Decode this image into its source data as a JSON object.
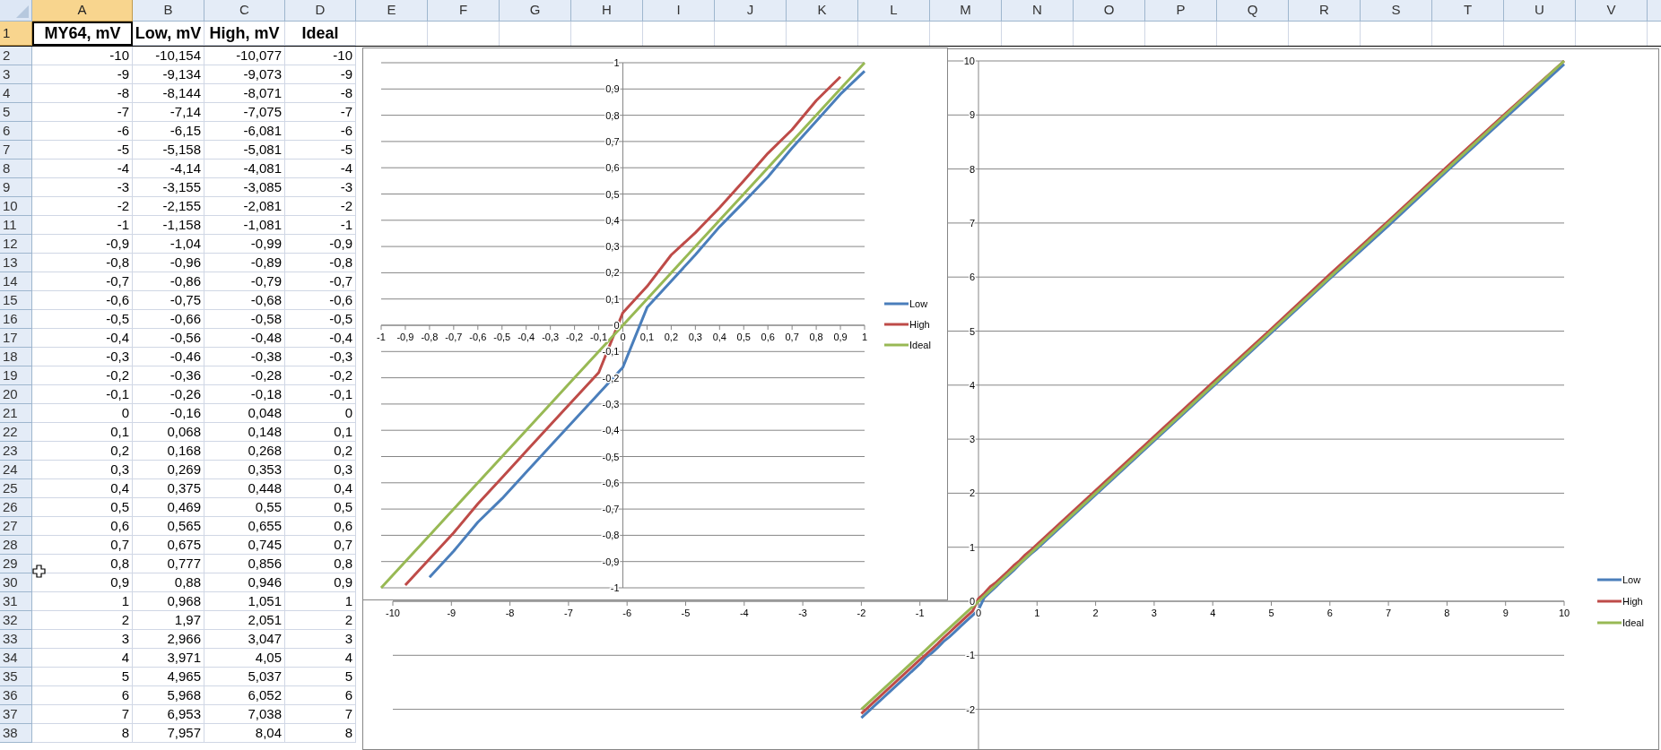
{
  "sheet": {
    "columns": [
      {
        "label": "A",
        "selected": true
      },
      {
        "label": "B",
        "selected": false
      },
      {
        "label": "C",
        "selected": false
      },
      {
        "label": "D",
        "selected": false
      },
      {
        "label": "E",
        "selected": false
      },
      {
        "label": "F",
        "selected": false
      },
      {
        "label": "G",
        "selected": false
      },
      {
        "label": "H",
        "selected": false
      },
      {
        "label": "I",
        "selected": false
      },
      {
        "label": "J",
        "selected": false
      },
      {
        "label": "K",
        "selected": false
      },
      {
        "label": "L",
        "selected": false
      },
      {
        "label": "M",
        "selected": false
      },
      {
        "label": "N",
        "selected": false
      },
      {
        "label": "O",
        "selected": false
      },
      {
        "label": "P",
        "selected": false
      },
      {
        "label": "Q",
        "selected": false
      },
      {
        "label": "R",
        "selected": false
      },
      {
        "label": "S",
        "selected": false
      },
      {
        "label": "T",
        "selected": false
      },
      {
        "label": "U",
        "selected": false
      },
      {
        "label": "V",
        "selected": false
      }
    ],
    "rows": [
      {
        "number": "1",
        "kind": "header",
        "selected": true,
        "cells": [
          "MY64, mV",
          "Low, mV",
          "High, mV",
          "Ideal"
        ]
      },
      {
        "number": "2",
        "kind": "data",
        "selected": false,
        "cells": [
          "-10",
          "-10,154",
          "-10,077",
          "-10"
        ]
      },
      {
        "number": "3",
        "kind": "data",
        "selected": false,
        "cells": [
          "-9",
          "-9,134",
          "-9,073",
          "-9"
        ]
      },
      {
        "number": "4",
        "kind": "data",
        "selected": false,
        "cells": [
          "-8",
          "-8,144",
          "-8,071",
          "-8"
        ]
      },
      {
        "number": "5",
        "kind": "data",
        "selected": false,
        "cells": [
          "-7",
          "-7,14",
          "-7,075",
          "-7"
        ]
      },
      {
        "number": "6",
        "kind": "data",
        "selected": false,
        "cells": [
          "-6",
          "-6,15",
          "-6,081",
          "-6"
        ]
      },
      {
        "number": "7",
        "kind": "data",
        "selected": false,
        "cells": [
          "-5",
          "-5,158",
          "-5,081",
          "-5"
        ]
      },
      {
        "number": "8",
        "kind": "data",
        "selected": false,
        "cells": [
          "-4",
          "-4,14",
          "-4,081",
          "-4"
        ]
      },
      {
        "number": "9",
        "kind": "data",
        "selected": false,
        "cells": [
          "-3",
          "-3,155",
          "-3,085",
          "-3"
        ]
      },
      {
        "number": "10",
        "kind": "data",
        "selected": false,
        "cells": [
          "-2",
          "-2,155",
          "-2,081",
          "-2"
        ]
      },
      {
        "number": "11",
        "kind": "data",
        "selected": false,
        "cells": [
          "-1",
          "-1,158",
          "-1,081",
          "-1"
        ]
      },
      {
        "number": "12",
        "kind": "data",
        "selected": false,
        "cells": [
          "-0,9",
          "-1,04",
          "-0,99",
          "-0,9"
        ]
      },
      {
        "number": "13",
        "kind": "data",
        "selected": false,
        "cells": [
          "-0,8",
          "-0,96",
          "-0,89",
          "-0,8"
        ]
      },
      {
        "number": "14",
        "kind": "data",
        "selected": false,
        "cells": [
          "-0,7",
          "-0,86",
          "-0,79",
          "-0,7"
        ]
      },
      {
        "number": "15",
        "kind": "data",
        "selected": false,
        "cells": [
          "-0,6",
          "-0,75",
          "-0,68",
          "-0,6"
        ]
      },
      {
        "number": "16",
        "kind": "data",
        "selected": false,
        "cells": [
          "-0,5",
          "-0,66",
          "-0,58",
          "-0,5"
        ]
      },
      {
        "number": "17",
        "kind": "data",
        "selected": false,
        "cells": [
          "-0,4",
          "-0,56",
          "-0,48",
          "-0,4"
        ]
      },
      {
        "number": "18",
        "kind": "data",
        "selected": false,
        "cells": [
          "-0,3",
          "-0,46",
          "-0,38",
          "-0,3"
        ]
      },
      {
        "number": "19",
        "kind": "data",
        "selected": false,
        "cells": [
          "-0,2",
          "-0,36",
          "-0,28",
          "-0,2"
        ]
      },
      {
        "number": "20",
        "kind": "data",
        "selected": false,
        "cells": [
          "-0,1",
          "-0,26",
          "-0,18",
          "-0,1"
        ]
      },
      {
        "number": "21",
        "kind": "data",
        "selected": false,
        "cells": [
          "0",
          "-0,16",
          "0,048",
          "0"
        ]
      },
      {
        "number": "22",
        "kind": "data",
        "selected": false,
        "cells": [
          "0,1",
          "0,068",
          "0,148",
          "0,1"
        ]
      },
      {
        "number": "23",
        "kind": "data",
        "selected": false,
        "cells": [
          "0,2",
          "0,168",
          "0,268",
          "0,2"
        ]
      },
      {
        "number": "24",
        "kind": "data",
        "selected": false,
        "cells": [
          "0,3",
          "0,269",
          "0,353",
          "0,3"
        ]
      },
      {
        "number": "25",
        "kind": "data",
        "selected": false,
        "cells": [
          "0,4",
          "0,375",
          "0,448",
          "0,4"
        ]
      },
      {
        "number": "26",
        "kind": "data",
        "selected": false,
        "cells": [
          "0,5",
          "0,469",
          "0,55",
          "0,5"
        ]
      },
      {
        "number": "27",
        "kind": "data",
        "selected": false,
        "cells": [
          "0,6",
          "0,565",
          "0,655",
          "0,6"
        ]
      },
      {
        "number": "28",
        "kind": "data",
        "selected": false,
        "cells": [
          "0,7",
          "0,675",
          "0,745",
          "0,7"
        ]
      },
      {
        "number": "29",
        "kind": "data",
        "selected": false,
        "cells": [
          "0,8",
          "0,777",
          "0,856",
          "0,8"
        ]
      },
      {
        "number": "30",
        "kind": "data",
        "selected": false,
        "cells": [
          "0,9",
          "0,88",
          "0,946",
          "0,9"
        ]
      },
      {
        "number": "31",
        "kind": "data",
        "selected": false,
        "cells": [
          "1",
          "0,968",
          "1,051",
          "1"
        ]
      },
      {
        "number": "32",
        "kind": "data",
        "selected": false,
        "cells": [
          "2",
          "1,97",
          "2,051",
          "2"
        ]
      },
      {
        "number": "33",
        "kind": "data",
        "selected": false,
        "cells": [
          "3",
          "2,966",
          "3,047",
          "3"
        ]
      },
      {
        "number": "34",
        "kind": "data",
        "selected": false,
        "cells": [
          "4",
          "3,971",
          "4,05",
          "4"
        ]
      },
      {
        "number": "35",
        "kind": "data",
        "selected": false,
        "cells": [
          "5",
          "4,965",
          "5,037",
          "5"
        ]
      },
      {
        "number": "36",
        "kind": "data",
        "selected": false,
        "cells": [
          "6",
          "5,968",
          "6,052",
          "6"
        ]
      },
      {
        "number": "37",
        "kind": "data",
        "selected": false,
        "cells": [
          "7",
          "6,953",
          "7,038",
          "7"
        ]
      },
      {
        "number": "38",
        "kind": "data",
        "selected": false,
        "cells": [
          "8",
          "7,957",
          "8,04",
          "8"
        ]
      }
    ]
  },
  "charts": [
    {
      "chart_data": {
        "type": "line",
        "grid": true,
        "legend": true,
        "x": [
          -1,
          -0.9,
          -0.8,
          -0.7,
          -0.6,
          -0.5,
          -0.4,
          -0.3,
          -0.2,
          -0.1,
          0,
          0.1,
          0.2,
          0.3,
          0.4,
          0.5,
          0.6,
          0.7,
          0.8,
          0.9,
          1
        ],
        "series": [
          {
            "name": "Low",
            "color": "#4a7ebb",
            "values": [
              null,
              null,
              -0.96,
              -0.86,
              -0.75,
              -0.66,
              -0.56,
              -0.46,
              -0.36,
              -0.26,
              -0.16,
              0.068,
              0.168,
              0.269,
              0.375,
              0.469,
              0.565,
              0.675,
              0.777,
              0.88,
              0.968
            ]
          },
          {
            "name": "High",
            "color": "#be4b48",
            "values": [
              null,
              -0.99,
              -0.89,
              -0.79,
              -0.68,
              -0.58,
              -0.48,
              -0.38,
              -0.28,
              -0.18,
              0.048,
              0.148,
              0.268,
              0.353,
              0.448,
              0.55,
              0.655,
              0.745,
              0.856,
              0.946,
              null
            ]
          },
          {
            "name": "Ideal",
            "color": "#98b954",
            "values": [
              -1,
              -0.9,
              -0.8,
              -0.7,
              -0.6,
              -0.5,
              -0.4,
              -0.3,
              -0.2,
              -0.1,
              0,
              0.1,
              0.2,
              0.3,
              0.4,
              0.5,
              0.6,
              0.7,
              0.8,
              0.9,
              1
            ]
          }
        ],
        "xlim": [
          -1,
          1
        ],
        "ylim": [
          -1,
          1
        ],
        "xticks": [
          -1,
          {
            "value": -0.9,
            "label": "-0,9"
          },
          {
            "value": -0.8,
            "label": "-0,8"
          },
          {
            "value": -0.7,
            "label": "-0,7"
          },
          {
            "value": -0.6,
            "label": "-0,6"
          },
          {
            "value": -0.5,
            "label": "-0,5"
          },
          {
            "value": -0.4,
            "label": "-0,4"
          },
          {
            "value": -0.3,
            "label": "-0,3"
          },
          {
            "value": -0.2,
            "label": "-0,2"
          },
          {
            "value": -0.1,
            "label": "-0,1"
          },
          0,
          {
            "value": 0.1,
            "label": "0,1"
          },
          {
            "value": 0.2,
            "label": "0,2"
          },
          {
            "value": 0.3,
            "label": "0,3"
          },
          {
            "value": 0.4,
            "label": "0,4"
          },
          {
            "value": 0.5,
            "label": "0,5"
          },
          {
            "value": 0.6,
            "label": "0,6"
          },
          {
            "value": 0.7,
            "label": "0,7"
          },
          {
            "value": 0.8,
            "label": "0,8"
          },
          {
            "value": 0.9,
            "label": "0,9"
          },
          1
        ],
        "yticks": [
          -1,
          {
            "value": -0.9,
            "label": "-0,9"
          },
          {
            "value": -0.8,
            "label": "-0,8"
          },
          {
            "value": -0.7,
            "label": "-0,7"
          },
          {
            "value": -0.6,
            "label": "-0,6"
          },
          {
            "value": -0.5,
            "label": "-0,5"
          },
          {
            "value": -0.4,
            "label": "-0,4"
          },
          {
            "value": -0.3,
            "label": "-0,3"
          },
          {
            "value": -0.2,
            "label": "-0,2"
          },
          {
            "value": -0.1,
            "label": "-0,1"
          },
          0,
          {
            "value": 0.1,
            "label": "0,1"
          },
          {
            "value": 0.2,
            "label": "0,2"
          },
          {
            "value": 0.3,
            "label": "0,3"
          },
          {
            "value": 0.4,
            "label": "0,4"
          },
          {
            "value": 0.5,
            "label": "0,5"
          },
          {
            "value": 0.6,
            "label": "0,6"
          },
          {
            "value": 0.7,
            "label": "0,7"
          },
          {
            "value": 0.8,
            "label": "0,8"
          },
          {
            "value": 0.9,
            "label": "0,9"
          },
          1
        ]
      }
    },
    {
      "chart_data": {
        "type": "line",
        "grid": true,
        "legend": true,
        "x": [
          -2,
          -1,
          -0.9,
          -0.8,
          -0.7,
          -0.6,
          -0.5,
          -0.4,
          -0.3,
          -0.2,
          -0.1,
          0,
          0.1,
          0.2,
          0.3,
          0.4,
          0.5,
          0.6,
          0.7,
          0.8,
          0.9,
          1,
          2,
          3,
          4,
          5,
          6,
          7,
          8,
          9,
          10
        ],
        "series": [
          {
            "name": "Low",
            "color": "#4a7ebb",
            "values": [
              -2.16,
              -1.16,
              -1.04,
              -0.96,
              -0.86,
              -0.75,
              -0.66,
              -0.56,
              -0.46,
              -0.36,
              -0.26,
              -0.16,
              0.07,
              0.17,
              0.27,
              0.38,
              0.47,
              0.57,
              0.68,
              0.78,
              0.88,
              0.97,
              1.97,
              2.97,
              3.97,
              4.97,
              5.97,
              6.95,
              7.96,
              8.95,
              9.94
            ]
          },
          {
            "name": "High",
            "color": "#be4b48",
            "values": [
              -2.08,
              -1.08,
              -0.99,
              -0.89,
              -0.79,
              -0.68,
              -0.58,
              -0.48,
              -0.38,
              -0.28,
              -0.18,
              0.05,
              0.15,
              0.27,
              0.35,
              0.45,
              0.55,
              0.66,
              0.75,
              0.86,
              0.95,
              1.05,
              2.05,
              3.05,
              4.05,
              5.04,
              6.05,
              7.04,
              8.04,
              9.03,
              10
            ]
          },
          {
            "name": "Ideal",
            "color": "#98b954",
            "values": [
              -2,
              -1,
              -0.9,
              -0.8,
              -0.7,
              -0.6,
              -0.5,
              -0.4,
              -0.3,
              -0.2,
              -0.1,
              0,
              0.1,
              0.2,
              0.3,
              0.4,
              0.5,
              0.6,
              0.7,
              0.8,
              0.9,
              1,
              2,
              3,
              4,
              5,
              6,
              7,
              8,
              9,
              10
            ]
          }
        ],
        "xlim": [
          -10,
          10
        ],
        "ylim": [
          -10,
          10
        ],
        "xticks": [
          -10,
          -9,
          -8,
          -7,
          -6,
          -5,
          -4,
          -3,
          -2,
          -1,
          0,
          1,
          2,
          3,
          4,
          5,
          6,
          7,
          8,
          9,
          10
        ],
        "yticks": [
          -2,
          -1,
          0,
          1,
          2,
          3,
          4,
          5,
          6,
          7,
          8,
          9,
          10
        ]
      }
    }
  ]
}
